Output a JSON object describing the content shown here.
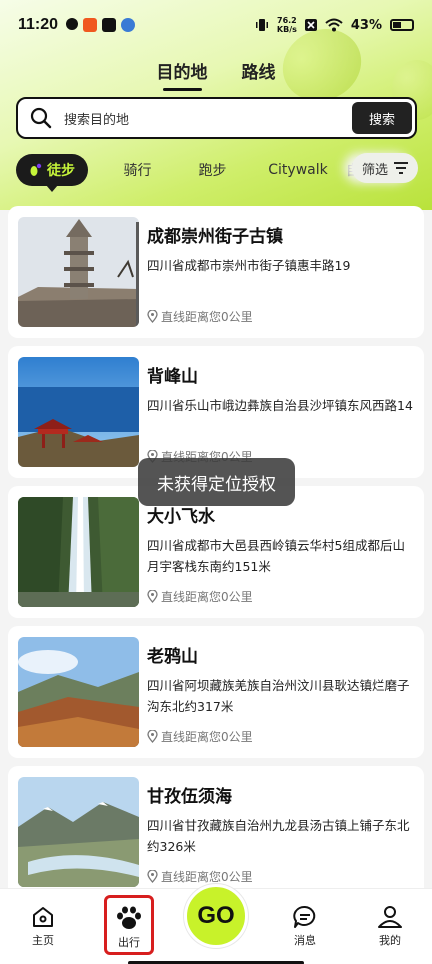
{
  "status": {
    "time": "11:20",
    "speed_value": "76.2",
    "speed_unit": "KB/s",
    "battery": "43%"
  },
  "tabs": [
    "目的地",
    "路线"
  ],
  "search": {
    "placeholder": "搜索目的地",
    "button": "搜索"
  },
  "categories": {
    "active": "徒步",
    "items": [
      "骑行",
      "跑步",
      "Citywalk"
    ],
    "cut": "自",
    "filter": "筛选"
  },
  "places": [
    {
      "name": "成都崇州街子古镇",
      "address": "四川省成都市崇州市街子镇惠丰路19",
      "distance": "直线距离您0公里"
    },
    {
      "name": "背峰山",
      "address": "四川省乐山市峨边彝族自治县沙坪镇东风西路14",
      "distance": "直线距离您0公里"
    },
    {
      "name": "大小飞水",
      "address": "四川省成都市大邑县西岭镇云华村5组成都后山月宇客栈东南约151米",
      "distance": "直线距离您0公里"
    },
    {
      "name": "老鸦山",
      "address": "四川省阿坝藏族羌族自治州汶川县耿达镇烂磨子沟东北约317米",
      "distance": "直线距离您0公里"
    },
    {
      "name": "甘孜伍须海",
      "address": "四川省甘孜藏族自治州九龙县汤古镇上铺子东北约326米",
      "distance": "直线距离您0公里"
    }
  ],
  "toast": "未获得定位授权",
  "nav": {
    "home": "主页",
    "travel": "出行",
    "go": "GO",
    "messages": "消息",
    "mine": "我的"
  }
}
